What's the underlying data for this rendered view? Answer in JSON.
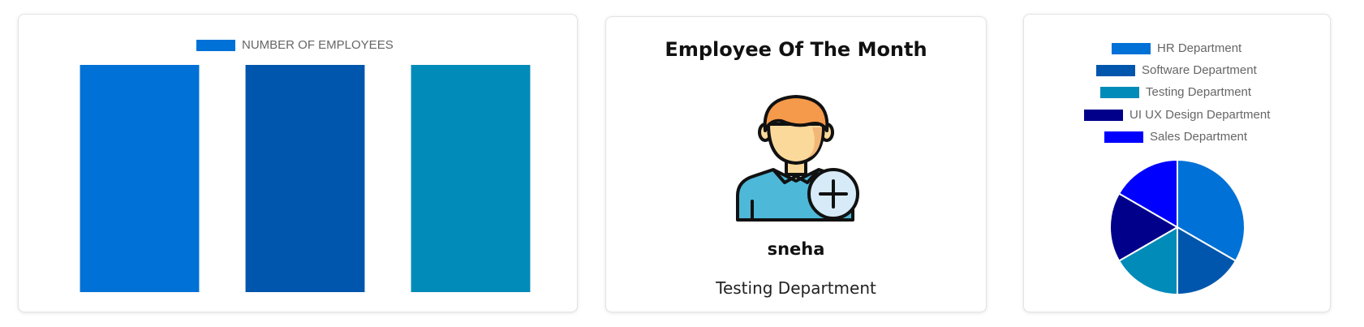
{
  "bar_card": {
    "chart_data": {
      "type": "bar",
      "categories": [
        "",
        "",
        ""
      ],
      "series": [
        {
          "name": "NUMBER OF EMPLOYEES",
          "values": [
            1,
            1,
            1
          ]
        }
      ],
      "bar_colors": [
        "#0071d6",
        "#0056ad",
        "#008bb8"
      ],
      "legend_color": "#0071d6",
      "ylim": [
        0,
        1
      ],
      "legend": "top"
    }
  },
  "employee_of_month": {
    "title": "Employee Of The Month",
    "name": "sneha",
    "department": "Testing Department",
    "avatar_icon": "user-add-icon"
  },
  "pie_card": {
    "chart_data": {
      "type": "pie",
      "labels": [
        "HR Department",
        "Software Department",
        "Testing Department",
        "UI UX Design Department",
        "Sales Department"
      ],
      "values": [
        2,
        1,
        1,
        1,
        1
      ],
      "colors": [
        "#0071d6",
        "#0056ad",
        "#008bb8",
        "#00008b",
        "#0000ff"
      ],
      "legend": "top"
    }
  }
}
